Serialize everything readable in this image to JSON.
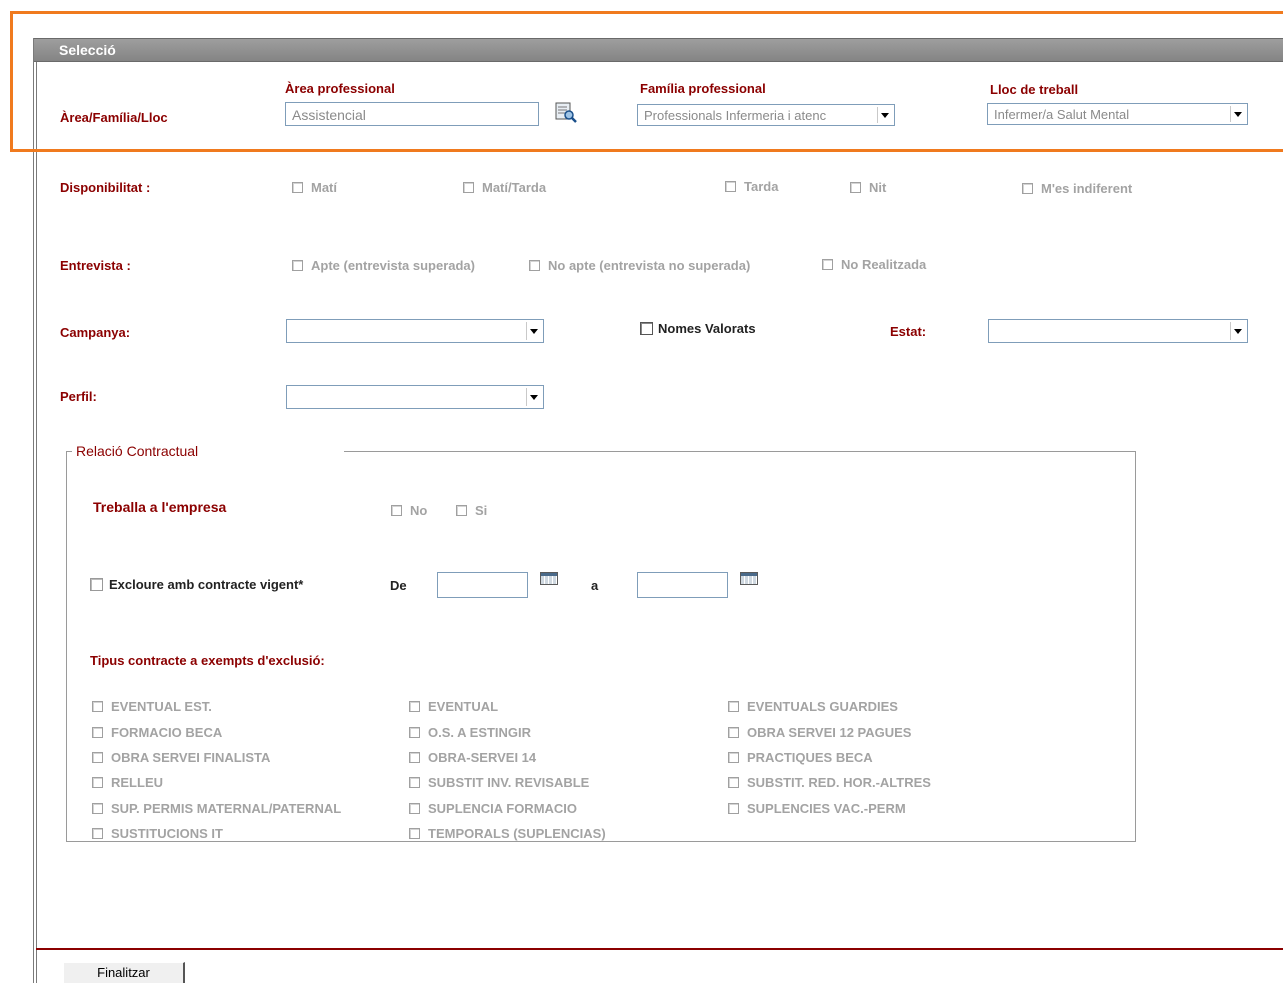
{
  "section_title": "Selecció",
  "area_row": {
    "label": "Àrea/Família/Lloc",
    "area_label": "Àrea professional",
    "area_value": "Assistencial",
    "familia_label": "Família professional",
    "familia_value": "Professionals Infermeria i atenc",
    "lloc_label": "Lloc de treball",
    "lloc_value": "Infermer/a Salut Mental"
  },
  "disponibilitat": {
    "label": "Disponibilitat :",
    "options": [
      "Matí",
      "Matí/Tarda",
      "Tarda",
      "Nit",
      "M'es indiferent"
    ]
  },
  "entrevista": {
    "label": "Entrevista :",
    "options": [
      "Apte (entrevista superada)",
      "No apte (entrevista no superada)",
      "No Realitzada"
    ]
  },
  "campanya": {
    "label": "Campanya:",
    "value": ""
  },
  "nomes_valorats": "Nomes Valorats",
  "estat": {
    "label": "Estat:",
    "value": ""
  },
  "perfil": {
    "label": "Perfil:",
    "value": ""
  },
  "relacio": {
    "legend": "Relació Contractual",
    "treballa_label": "Treballa a l'empresa",
    "treballa_no": "No",
    "treballa_si": "Si",
    "excloure_label": "Excloure amb contracte vigent*",
    "de_label": "De",
    "a_label": "a",
    "tipus_label": "Tipus contracte a exempts d'exclusió:",
    "tipus_col1": [
      "EVENTUAL EST.",
      "FORMACIO BECA",
      "OBRA SERVEI FINALISTA",
      "RELLEU",
      "SUP. PERMIS MATERNAL/PATERNAL",
      "SUSTITUCIONS IT"
    ],
    "tipus_col2": [
      "EVENTUAL",
      "O.S. A ESTINGIR",
      "OBRA-SERVEI 14",
      "SUBSTIT INV. REVISABLE",
      "SUPLENCIA FORMACIO",
      "TEMPORALS (SUPLENCIAS)"
    ],
    "tipus_col3": [
      "EVENTUALS GUARDIES",
      "OBRA SERVEI 12 PAGUES",
      "PRACTIQUES BECA",
      "SUBSTIT. RED. HOR.-ALTRES",
      "SUPLENCIES VAC.-PERM"
    ]
  },
  "finish_button": "Finalitzar",
  "colors": {
    "accent_red": "#8b0000",
    "highlight_orange": "#f07a1e",
    "titlebar_grey": "#8c8c8c"
  }
}
